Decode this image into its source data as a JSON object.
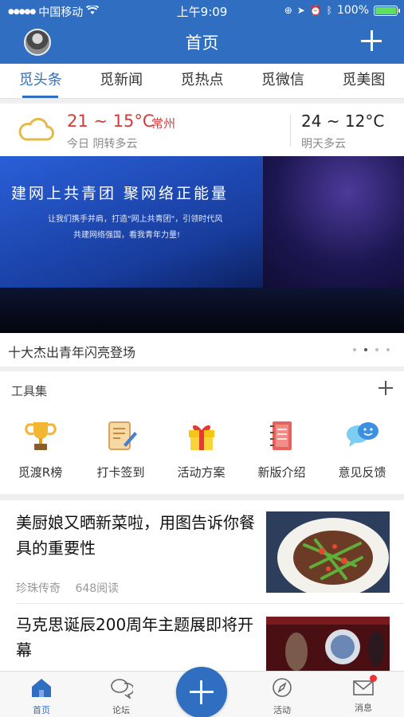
{
  "status_bar": {
    "carrier": "中国移动",
    "time": "上午9:09",
    "battery": "100%",
    "battery_level": 1.0
  },
  "header": {
    "title": "首页"
  },
  "tabs": [
    {
      "label": "觅头条",
      "active": true
    },
    {
      "label": "觅新闻",
      "active": false
    },
    {
      "label": "觅热点",
      "active": false
    },
    {
      "label": "觅微信",
      "active": false
    },
    {
      "label": "觅美图",
      "active": false
    }
  ],
  "weather": {
    "today_temp": "21 ~ 15°C",
    "city": "常州",
    "today_desc": "今日 阴转多云",
    "tomorrow_temp": "24 ~ 12°C",
    "tomorrow_desc": "明天多云",
    "icon": "cloud-icon",
    "accent_color": "#d33b3b"
  },
  "banner": {
    "headline": "建网上共青团  聚网络正能量",
    "line1": "让我们携手并肩，打造\"网上共青团\"，引领时代风",
    "line2": "共建网络强国，看我青年力量!",
    "caption": "十大杰出青年闪亮登场",
    "page_count": 4,
    "active_page": 2
  },
  "tools": {
    "title": "工具集",
    "items": [
      {
        "label": "觅渡R榜",
        "icon": "trophy-icon"
      },
      {
        "label": "打卡签到",
        "icon": "scroll-pen-icon"
      },
      {
        "label": "活动方案",
        "icon": "gift-icon"
      },
      {
        "label": "新版介绍",
        "icon": "notebook-icon"
      },
      {
        "label": "意见反馈",
        "icon": "chat-bubbles-icon"
      }
    ]
  },
  "articles": [
    {
      "title": "美厨娘又晒新菜啦，用图告诉你餐具的重要性",
      "source": "珍珠传奇",
      "reads": "648阅读",
      "thumb": "food-plate-image"
    },
    {
      "title": "马克思诞辰200周年主题展即将开幕",
      "source": "",
      "reads": "",
      "thumb": "exhibition-image"
    }
  ],
  "bottom_nav": [
    {
      "label": "首页",
      "icon": "home-icon",
      "active": true
    },
    {
      "label": "论坛",
      "icon": "chat-icon",
      "active": false
    },
    {
      "label": "活动",
      "icon": "compass-icon",
      "active": false
    },
    {
      "label": "消息",
      "icon": "mail-icon",
      "active": false
    }
  ],
  "colors": {
    "brand": "#2f6ec0",
    "background": "#efeff2"
  }
}
